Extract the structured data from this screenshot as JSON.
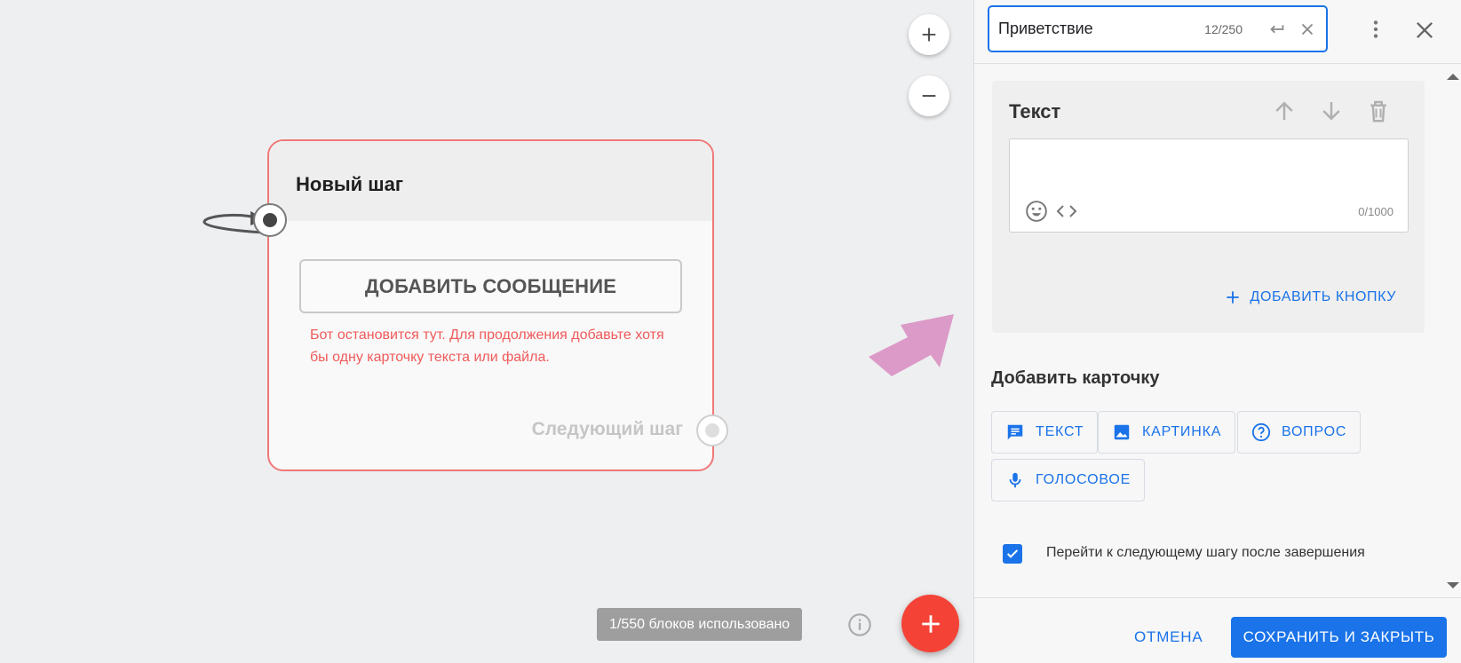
{
  "canvas": {
    "node": {
      "title": "Новый шаг",
      "add_message_label": "ДОБАВИТЬ СООБЩЕНИЕ",
      "error_text": "Бот остановится тут. Для продолжения добавьте хотя бы одну карточку текста или файла.",
      "next_step_label": "Следующий шаг"
    },
    "blocks_used": "1/550 блоков использовано",
    "colors": {
      "node_border": "#f07878",
      "error": "#f05a5a",
      "fab": "#f44336",
      "pink_arrow": "#dc9ac8"
    }
  },
  "panel": {
    "name_input_value": "Приветствие",
    "name_counter": "12/250",
    "text_card": {
      "title": "Текст",
      "placeholder": "",
      "counter": "0/1000",
      "add_button_label": "ДОБАВИТЬ КНОПКУ"
    },
    "add_card": {
      "title": "Добавить карточку",
      "types": [
        {
          "label": "ТЕКСТ",
          "icon": "message-icon"
        },
        {
          "label": "КАРТИНКА",
          "icon": "image-icon"
        },
        {
          "label": "ВОПРОС",
          "icon": "help-circle-icon"
        },
        {
          "label": "ГОЛОСОВОЕ",
          "icon": "microphone-icon"
        }
      ]
    },
    "go_next_checkbox": {
      "label": "Перейти к следующему шагу после завершения",
      "checked": true
    },
    "footer": {
      "cancel_label": "ОТМЕНА",
      "save_label": "СОХРАНИТЬ И ЗАКРЫТЬ"
    },
    "accent_color": "#1a73e8"
  }
}
